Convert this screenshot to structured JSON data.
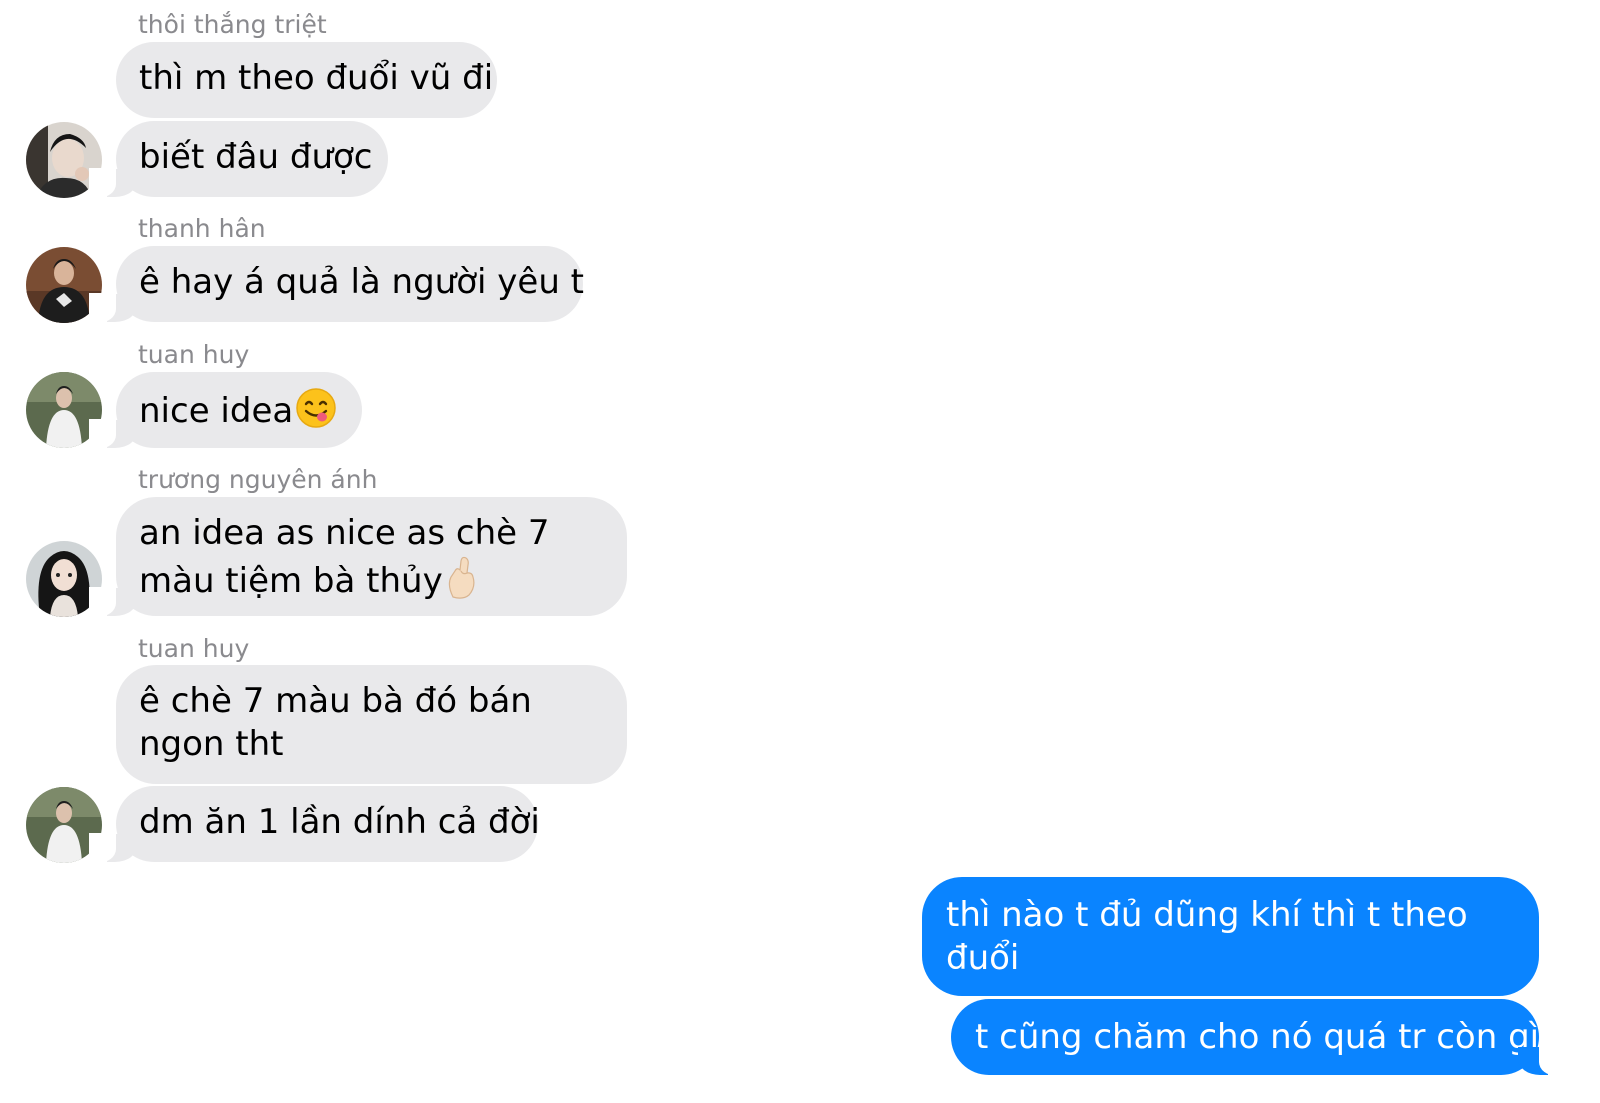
{
  "messages": [
    {
      "sender": "thôi thắng triệt",
      "texts": [
        "thì m theo đuổi vũ đi",
        "biết đâu được"
      ]
    },
    {
      "sender": "thanh hân",
      "texts": [
        "ê hay á quả là người yêu t"
      ]
    },
    {
      "sender": "tuan huy",
      "texts": [
        "nice idea"
      ],
      "emoji": "savoring-food-face-emoji"
    },
    {
      "sender": "trương nguyên ánh",
      "lines": [
        "an idea as nice as chè 7",
        "màu tiệm bà thủy"
      ],
      "emoji": "hand-heart-fingers-emoji"
    },
    {
      "sender": "tuan huy",
      "lines": [
        "ê chè 7 màu bà đó bán",
        "ngon tht"
      ],
      "texts": [
        "dm ăn 1 lần dính cả đời"
      ]
    }
  ],
  "outgoing": [
    {
      "lines": [
        "thì nào t đủ dũng khí thì t theo",
        "đuổi"
      ]
    },
    {
      "text": "t cũng chăm cho nó quá tr còn gì"
    }
  ],
  "colors": {
    "incoming_bubble": "#e9e9eb",
    "outgoing_bubble": "#0a84ff",
    "sender_name": "#8a8a8e"
  }
}
